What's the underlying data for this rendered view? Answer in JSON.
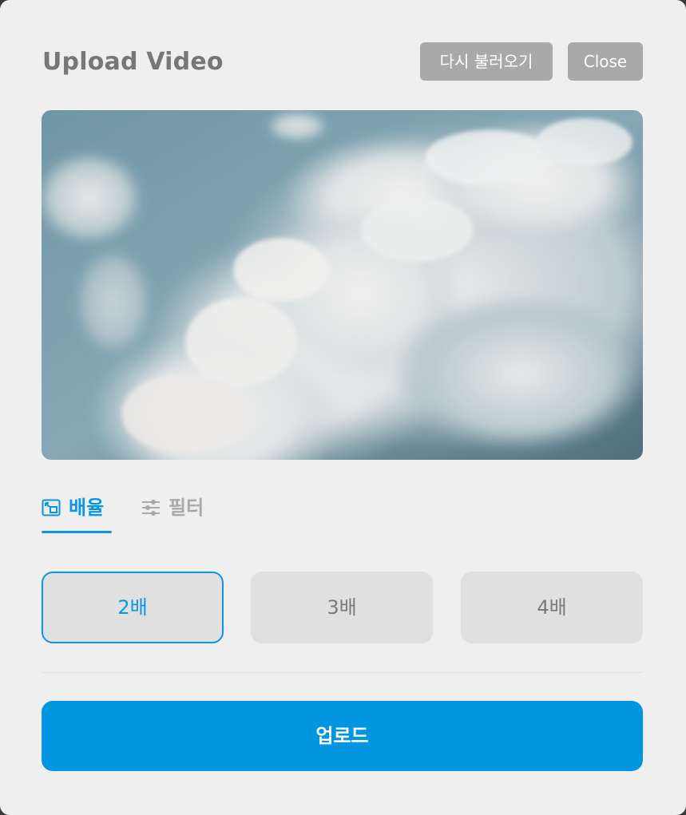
{
  "dialog": {
    "title": "Upload Video",
    "reload_label": "다시 불러오기",
    "close_label": "Close"
  },
  "preview": {
    "icon": "video-frame-clouds"
  },
  "tabs": [
    {
      "label": "배율",
      "icon": "zoom-icon",
      "active": true
    },
    {
      "label": "필터",
      "icon": "sliders-icon",
      "active": false
    }
  ],
  "zoom_options": [
    {
      "label": "2배",
      "selected": true
    },
    {
      "label": "3배",
      "selected": false
    },
    {
      "label": "4배",
      "selected": false
    }
  ],
  "upload_label": "업로드",
  "colors": {
    "accent": "#0396e0",
    "background": "#efefef",
    "header_button": "#a9a9a9",
    "option_bg": "#e0e0e0"
  }
}
